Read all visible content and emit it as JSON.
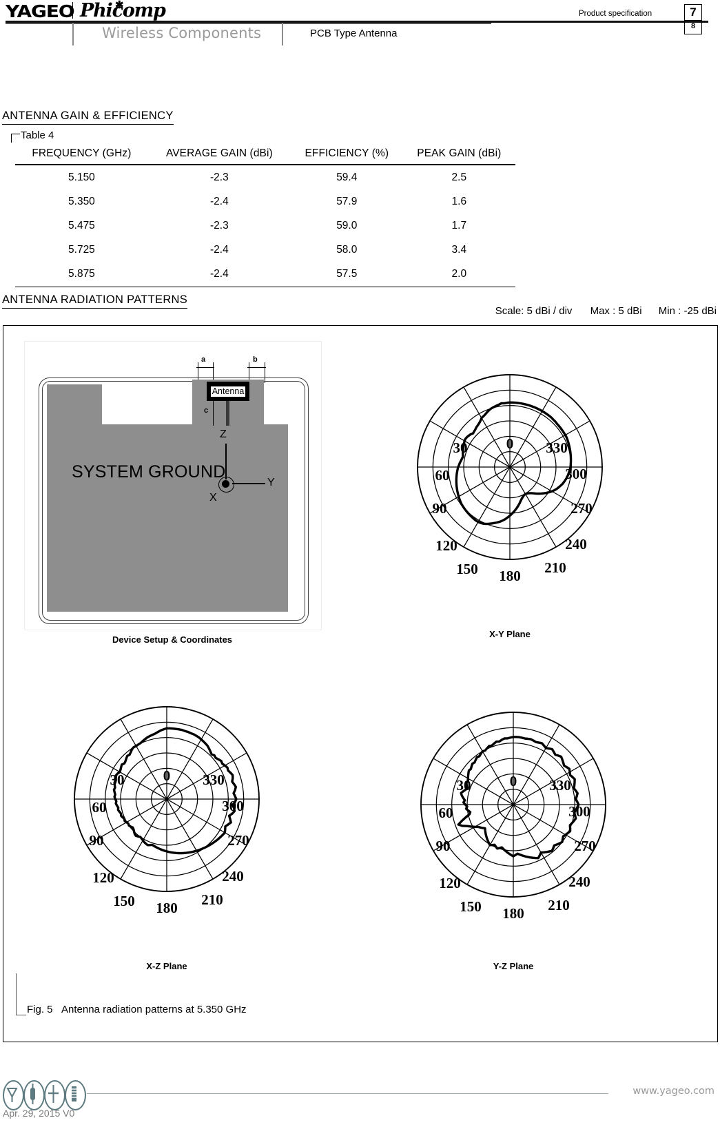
{
  "header": {
    "brand_yageo": "YAGEO",
    "brand_phicomp": "Phicomp",
    "tagline": "Wireless Components",
    "product_line": "PCB Type Antenna",
    "doc_type": "Product specification",
    "page_current": "7",
    "page_total": "8"
  },
  "sections": {
    "gain_efficiency_title": "ANTENNA GAIN & EFFICIENCY",
    "radiation_title": "ANTENNA RADIATION PATTERNS"
  },
  "table4": {
    "caption": "Table 4",
    "columns": [
      "FREQUENCY (GHz)",
      "AVERAGE GAIN (dBi)",
      "EFFICIENCY (%)",
      "PEAK GAIN (dBi)"
    ],
    "rows": [
      [
        "5.150",
        "-2.3",
        "59.4",
        "2.5"
      ],
      [
        "5.350",
        "-2.4",
        "57.9",
        "1.6"
      ],
      [
        "5.475",
        "-2.3",
        "59.0",
        "1.7"
      ],
      [
        "5.725",
        "-2.4",
        "58.0",
        "3.4"
      ],
      [
        "5.875",
        "-2.4",
        "57.5",
        "2.0"
      ]
    ]
  },
  "scale": {
    "divisions": "Scale: 5 dBi / div",
    "max": "Max  : 5 dBi",
    "min": "Min   : -25 dBi"
  },
  "device_setup": {
    "caption": "Device Setup & Coordinates",
    "ground_label": "SYSTEM GROUND",
    "antenna_label": "Antenna",
    "dim_a": "a",
    "dim_b": "b",
    "dim_c": "c",
    "axis_x": "X",
    "axis_y": "Y",
    "axis_z": "Z"
  },
  "figure": {
    "number": "Fig. 5",
    "caption": "Antenna radiation patterns at 5.350 GHz"
  },
  "chart_data": [
    {
      "type": "line",
      "title": "X-Y Plane",
      "coordinate_system": "polar",
      "rlabel": "dBi",
      "rlim": [
        -25,
        5
      ],
      "r_div": 5,
      "rings": 6,
      "theta_ticks": [
        "0",
        "30",
        "60",
        "90",
        "120",
        "150",
        "180",
        "210",
        "240",
        "270",
        "300",
        "330"
      ],
      "theta_direction": "counterclockwise-labels",
      "values": [
        -4.0,
        -4.1,
        -4.2,
        -4.1,
        -4.4,
        -4.6,
        -4.8,
        -5.0,
        -5.3,
        -5.7,
        -6.1,
        -6.4,
        -6.6,
        -7.2,
        -7.6,
        -7.9,
        -8.1,
        -8.4,
        -8.6,
        -8.8,
        -8.4,
        -8.2,
        -8.0,
        -7.9,
        -8.0,
        -8.2,
        -8.4,
        -8.6,
        -8.8,
        -9.0,
        -9.2,
        -9.4,
        -9.2,
        -9.0,
        -8.7,
        -8.5,
        -8.2,
        -8.0,
        -7.8,
        -7.6,
        -7.4,
        -7.2,
        -7.0,
        -6.8,
        -6.6,
        -6.4,
        -6.2,
        -6.0,
        -5.8,
        -5.6,
        -5.4,
        -5.2,
        -5.1,
        -5.0,
        -4.9,
        -4.8,
        -4.7,
        -4.6,
        -4.5,
        -4.4,
        -4.4,
        -4.5,
        -4.7,
        -5.0,
        -5.4,
        -5.8,
        -6.2,
        -6.6,
        -7.0,
        -7.5,
        -8.0,
        -8.6,
        -9.2,
        -9.8,
        -10.4,
        -11.0,
        -11.6,
        -12.2,
        -12.8,
        -13.4,
        -13.9,
        -14.3,
        -14.6,
        -14.8,
        -14.9,
        -14.8,
        -14.6,
        -14.3,
        -13.9,
        -13.4,
        -12.8,
        -12.2,
        -11.6,
        -11.0,
        -10.4,
        -9.8,
        -9.2,
        -8.7,
        -8.2,
        -7.8,
        -7.4,
        -7.0,
        -6.7,
        -6.4,
        -6.1,
        -5.9,
        -5.7,
        -5.5,
        -5.3,
        -5.2,
        -5.1,
        -5.0,
        -4.9,
        -4.8,
        -4.7,
        -4.6,
        -4.5,
        -4.4,
        -4.3,
        -4.2,
        -4.2,
        -4.2,
        -4.2,
        -4.2,
        -4.2,
        -4.2,
        -4.1,
        -4.1,
        -4.0,
        -4.0,
        -4.0,
        -4.0,
        -4.0,
        -4.0,
        -4.0,
        -4.0,
        -4.0,
        -4.0,
        -4.0,
        -4.0,
        -4.0,
        -4.0,
        -4.0,
        -4.0
      ]
    },
    {
      "type": "line",
      "title": "X-Z Plane",
      "coordinate_system": "polar",
      "rlabel": "dBi",
      "rlim": [
        -25,
        5
      ],
      "r_div": 5,
      "rings": 6,
      "theta_ticks": [
        "0",
        "30",
        "60",
        "90",
        "120",
        "150",
        "180",
        "210",
        "240",
        "270",
        "300",
        "330"
      ],
      "values": [
        -2.0,
        -2.3,
        -2.6,
        -3.0,
        -3.4,
        -3.6,
        -3.8,
        -4.0,
        -4.3,
        -4.6,
        -4.9,
        -5.0,
        -5.1,
        -5.0,
        -5.3,
        -5.8,
        -6.2,
        -6.0,
        -6.4,
        -6.8,
        -7.0,
        -6.6,
        -6.9,
        -7.2,
        -7.4,
        -7.0,
        -6.8,
        -7.1,
        -7.4,
        -7.2,
        -7.5,
        -7.8,
        -7.6,
        -7.9,
        -8.2,
        -8.0,
        -8.3,
        -8.6,
        -8.4,
        -8.7,
        -9.0,
        -8.8,
        -9.1,
        -9.4,
        -9.2,
        -9.5,
        -9.8,
        -9.6,
        -9.9,
        -10.2,
        -10.0,
        -10.3,
        -10.6,
        -10.4,
        -10.0,
        -9.6,
        -9.4,
        -9.7,
        -10.0,
        -9.8,
        -9.5,
        -9.2,
        -9.0,
        -8.8,
        -9.1,
        -9.4,
        -9.2,
        -9.0,
        -8.8,
        -8.6,
        -8.4,
        -8.2,
        -8.0,
        -7.8,
        -7.6,
        -7.4,
        -7.2,
        -7.0,
        -6.8,
        -6.6,
        -6.4,
        -6.2,
        -6.0,
        -5.8,
        -5.6,
        -5.4,
        -5.2,
        -5.0,
        -4.8,
        -4.6,
        -4.4,
        -4.2,
        -4.0,
        -3.8,
        -3.6,
        -3.4,
        -3.2,
        -3.6,
        -4.0,
        -3.4,
        -2.8,
        -3.4,
        -4.0,
        -3.2,
        -2.6,
        -3.0,
        -3.5,
        -2.8,
        -2.4,
        -2.8,
        -3.2,
        -2.6,
        -2.2,
        -2.6,
        -3.0,
        -2.5,
        -2.2,
        -2.6,
        -3.0,
        -2.8,
        -3.2,
        -3.6,
        -3.4,
        -3.8,
        -4.2,
        -4.0,
        -4.4,
        -4.0,
        -3.6,
        -3.2,
        -3.0,
        -2.8,
        -2.6,
        -2.4,
        -2.3,
        -2.2,
        -2.2,
        -2.1,
        -2.1,
        -2.0,
        -2.0,
        -2.0,
        -2.0,
        -2.0
      ]
    },
    {
      "type": "line",
      "title": "Y-Z Plane",
      "coordinate_system": "polar",
      "rlabel": "dBi",
      "rlim": [
        -25,
        5
      ],
      "r_div": 5,
      "rings": 6,
      "theta_ticks": [
        "0",
        "30",
        "60",
        "90",
        "120",
        "150",
        "180",
        "210",
        "240",
        "270",
        "300",
        "330"
      ],
      "values": [
        -3.0,
        -3.2,
        -3.4,
        -3.3,
        -3.6,
        -4.0,
        -3.8,
        -4.2,
        -4.6,
        -4.4,
        -4.8,
        -5.2,
        -5.0,
        -5.4,
        -5.8,
        -5.6,
        -6.0,
        -6.4,
        -6.2,
        -6.6,
        -7.0,
        -6.8,
        -7.2,
        -7.6,
        -8.0,
        -8.4,
        -8.2,
        -8.6,
        -9.0,
        -8.8,
        -8.2,
        -7.6,
        -8.0,
        -8.6,
        -9.2,
        -8.8,
        -9.4,
        -10.0,
        -9.6,
        -10.2,
        -10.8,
        -10.4,
        -9.0,
        -7.5,
        -6.0,
        -7.0,
        -8.5,
        -9.5,
        -10.5,
        -11.5,
        -12.0,
        -12.5,
        -13.0,
        -12.6,
        -12.2,
        -11.8,
        -11.4,
        -11.0,
        -10.6,
        -10.2,
        -9.8,
        -10.2,
        -10.6,
        -10.2,
        -9.8,
        -10.2,
        -10.6,
        -10.2,
        -9.8,
        -9.4,
        -9.0,
        -8.6,
        -8.2,
        -8.6,
        -9.0,
        -8.6,
        -8.2,
        -7.8,
        -7.4,
        -7.0,
        -6.6,
        -6.2,
        -5.8,
        -6.4,
        -7.0,
        -6.6,
        -6.2,
        -5.8,
        -5.4,
        -5.8,
        -6.2,
        -5.8,
        -5.4,
        -5.0,
        -5.4,
        -5.8,
        -5.4,
        -5.0,
        -4.6,
        -5.0,
        -5.4,
        -5.0,
        -4.6,
        -4.2,
        -4.6,
        -5.0,
        -4.6,
        -4.2,
        -3.8,
        -4.2,
        -4.6,
        -4.2,
        -3.8,
        -4.2,
        -4.6,
        -4.2,
        -3.8,
        -3.4,
        -3.8,
        -4.2,
        -3.8,
        -3.4,
        -3.8,
        -4.2,
        -3.8,
        -3.4,
        -3.0,
        -3.4,
        -3.8,
        -3.4,
        -3.0,
        -3.4,
        -3.8,
        -3.4,
        -3.0,
        -3.2,
        -3.4,
        -3.2,
        -3.0,
        -3.1,
        -3.2,
        -3.1,
        -3.0,
        -3.0
      ]
    }
  ],
  "footer": {
    "url": "www.yageo.com",
    "date_version": "Apr. 29, 2015 V0"
  }
}
